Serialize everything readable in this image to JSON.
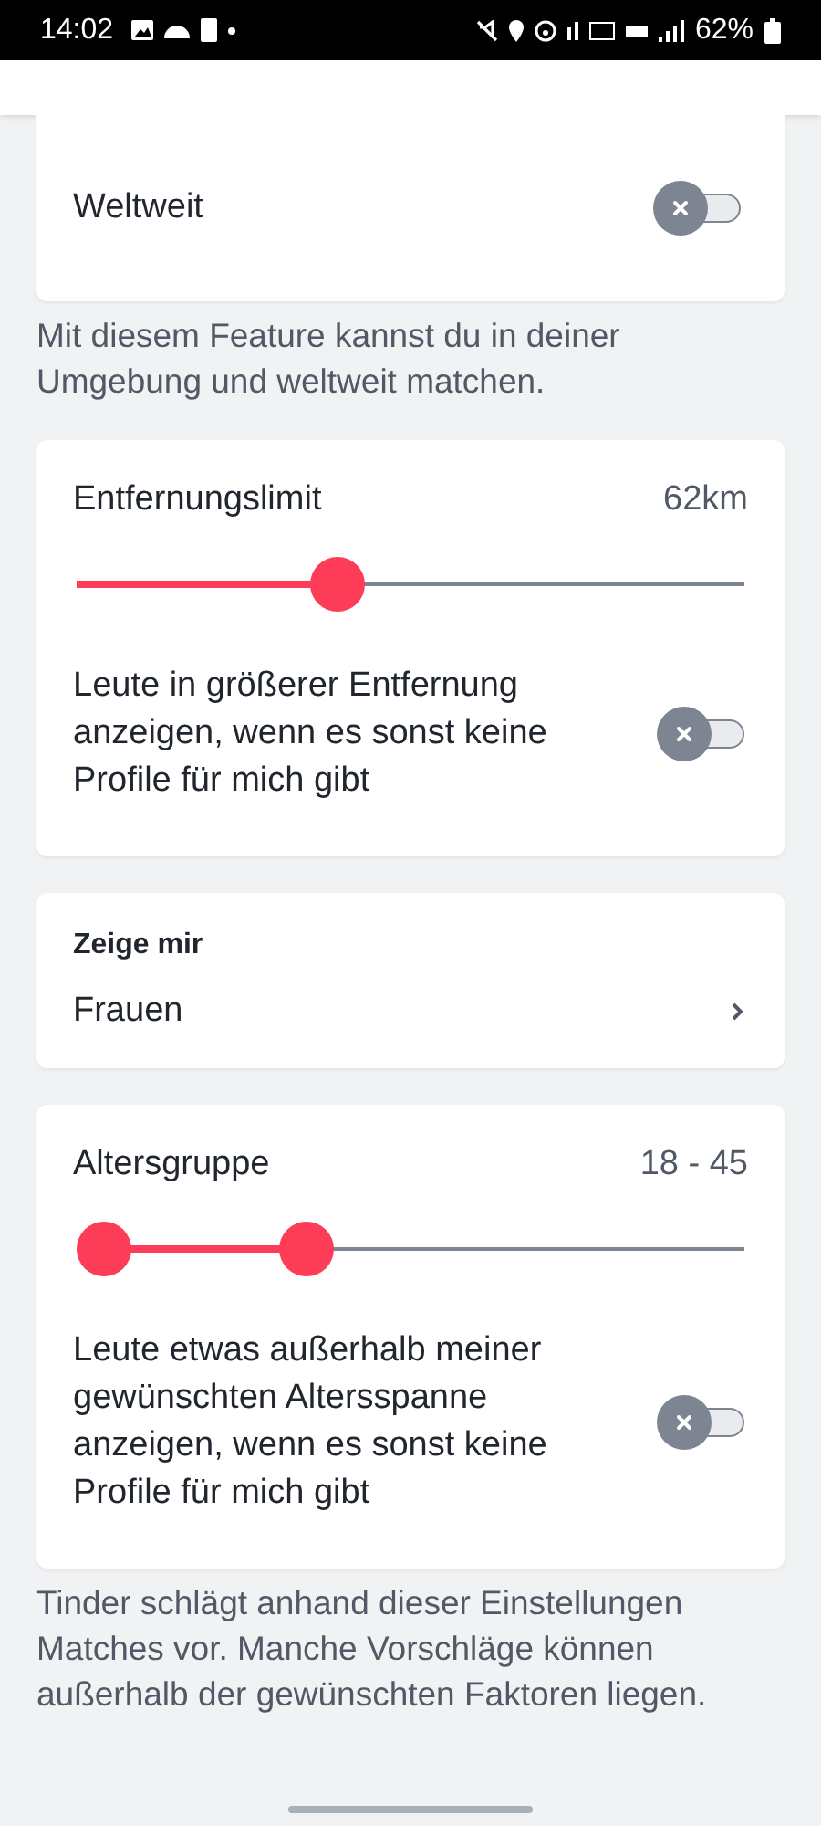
{
  "status_bar": {
    "time": "14:02",
    "battery": "62%"
  },
  "sections": [
    {
      "kind": "toggle_card",
      "label": "Weltweit",
      "on": false,
      "caption": "Mit diesem Feature kannst du in deiner Umgebung und weltweit matchen."
    },
    {
      "kind": "slider_card",
      "label": "Entfernungslimit",
      "reading": "62km",
      "thumbs": [
        {
          "level": 0.39
        }
      ],
      "option": {
        "label": "Leute in größerer Entfernung anzeigen, wenn es sonst keine Profile für mich gibt",
        "on": false
      }
    },
    {
      "kind": "link_card",
      "heading": "Zeige mir",
      "value": "Frauen"
    },
    {
      "kind": "slider_card",
      "label": "Altersgruppe",
      "reading": "18 - 45",
      "thumbs": [
        {
          "level": 0.04
        },
        {
          "level": 0.345
        }
      ],
      "option": {
        "label": "Leute etwas außerhalb meiner gewünschten Altersspanne anzeigen, wenn es sonst keine Profile für mich gibt",
        "on": false
      },
      "caption": "Tinder schlägt anhand dieser Einstellungen Matches vor. Manche Vorschläge können außerhalb der gewünschten Faktoren liegen."
    }
  ]
}
